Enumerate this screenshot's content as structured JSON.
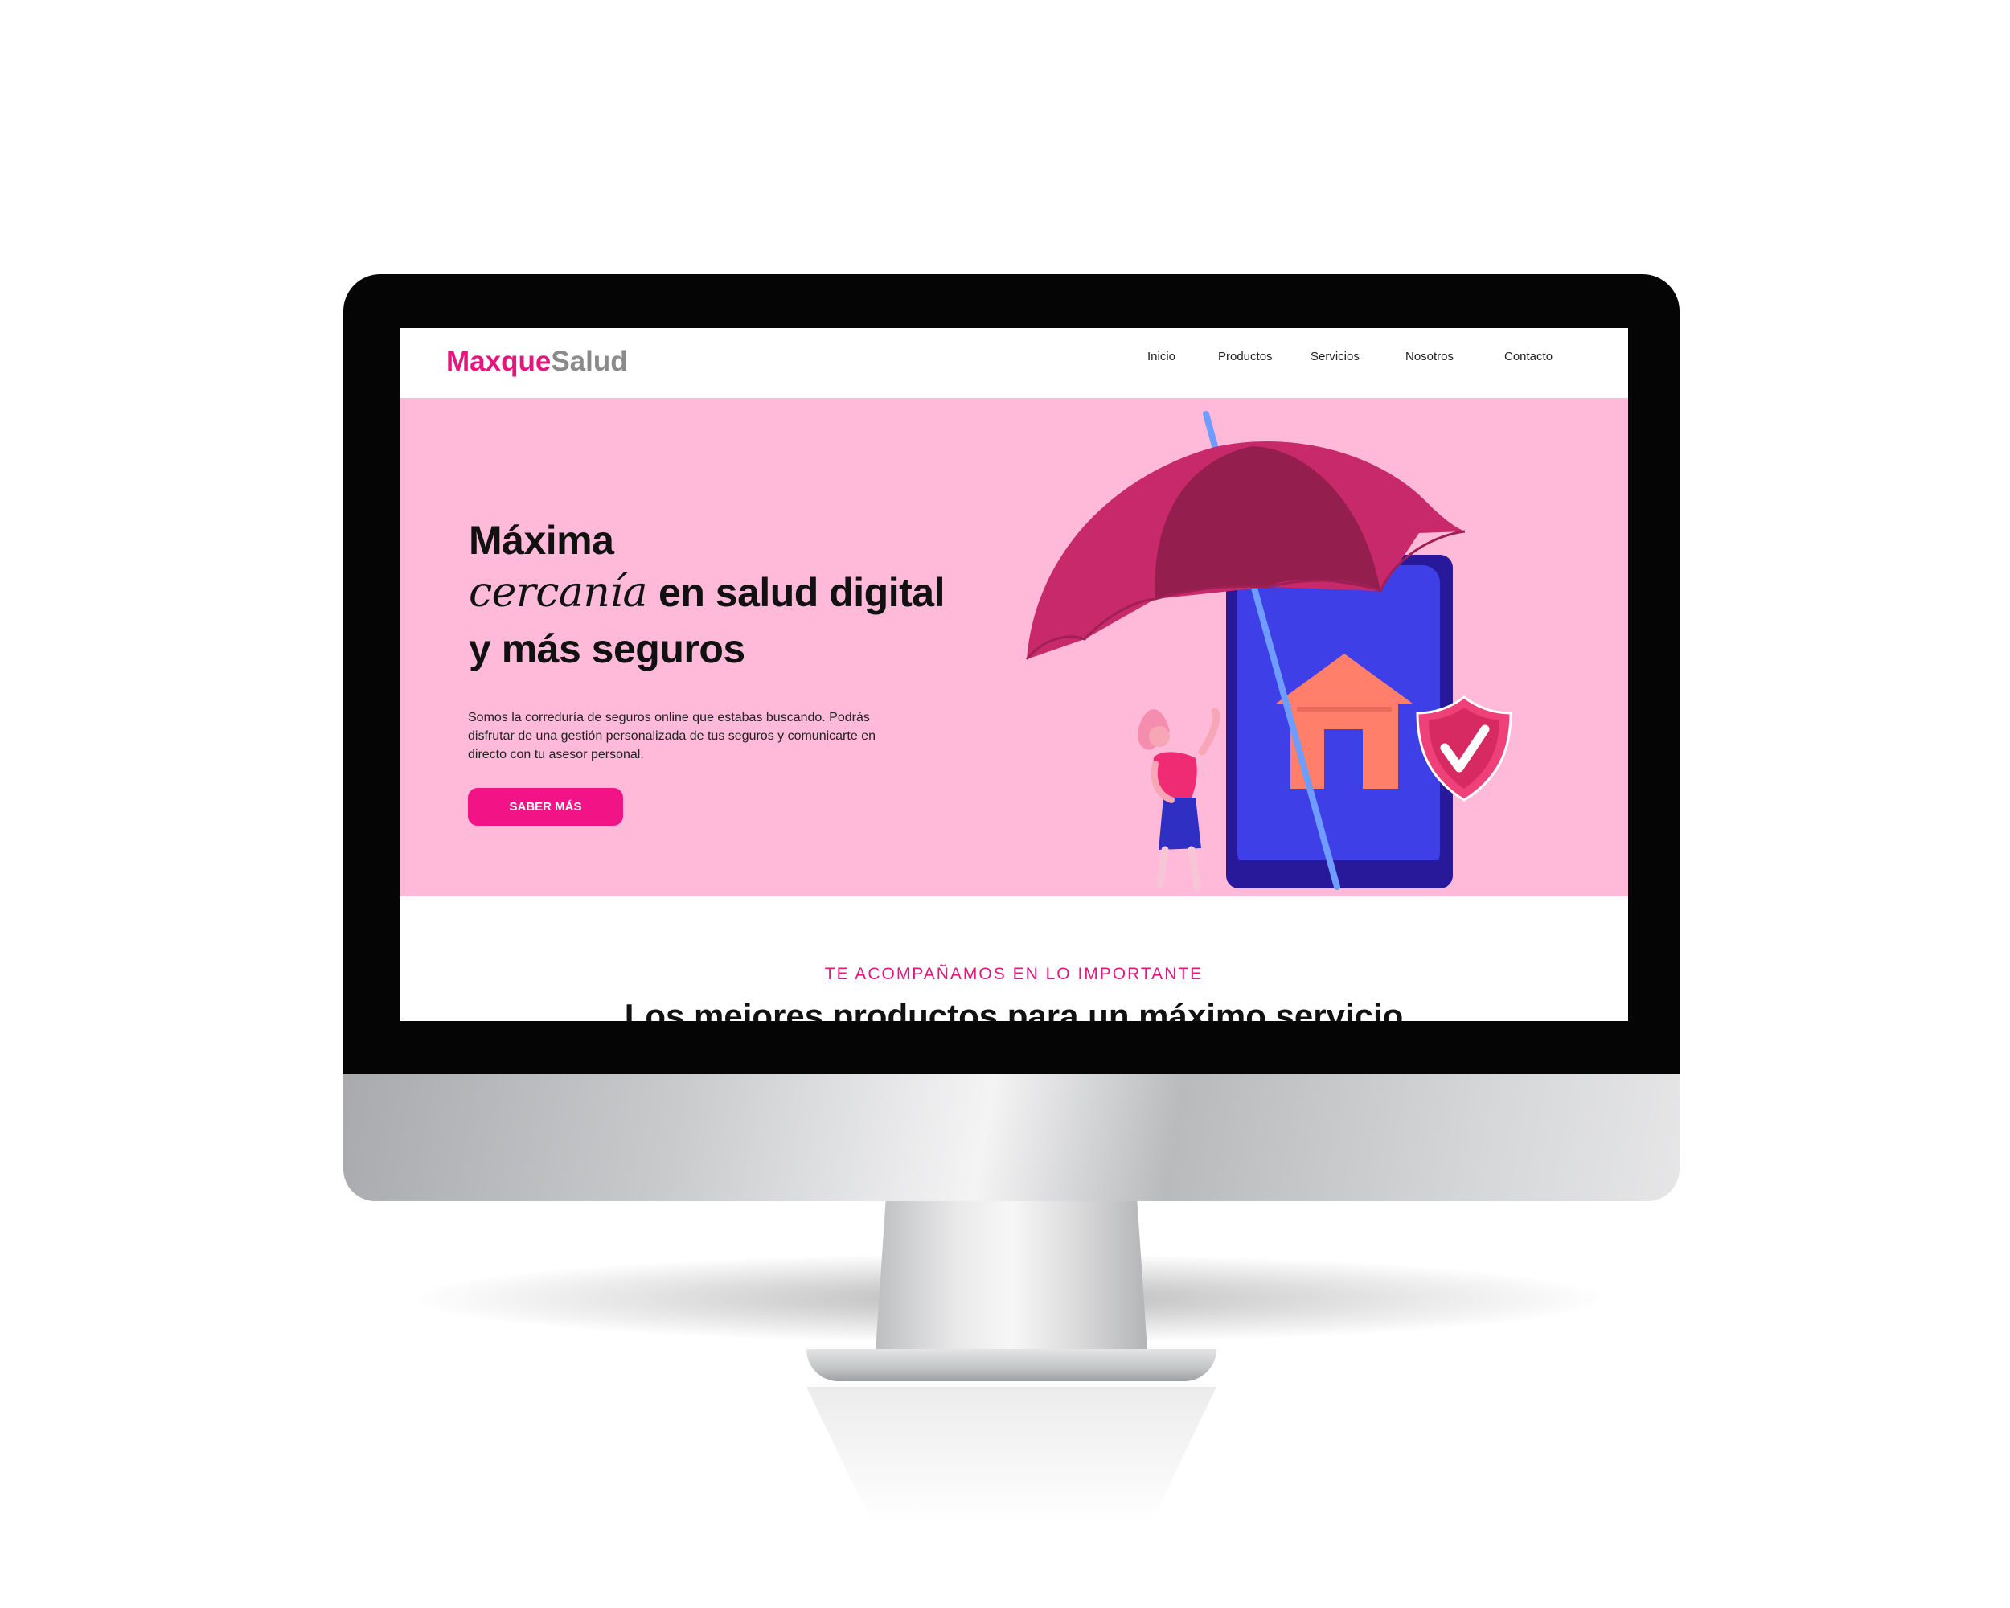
{
  "site": {
    "logo_primary": "Maxque",
    "logo_secondary": "Salud"
  },
  "nav": {
    "items": [
      {
        "label": "Inicio"
      },
      {
        "label": "Productos"
      },
      {
        "label": "Servicios"
      },
      {
        "label": "Nosotros"
      },
      {
        "label": "Contacto"
      }
    ]
  },
  "hero": {
    "title_line1": "Máxima",
    "title_script": "cercanía",
    "title_line2_rest": "en salud digital",
    "title_line3": "y más seguros",
    "description": "Somos la correduría de seguros online que estabas buscando. Podrás disfrutar de una gestión personalizada de tus seguros y comunicarte en directo con tu asesor personal.",
    "button_label": "SABER MÁS"
  },
  "section": {
    "eyebrow": "TE ACOMPAÑAMOS EN LO IMPORTANTE",
    "title": "Los mejores productos para un máximo servicio"
  },
  "colors": {
    "brand_pink": "#e6157e",
    "hero_background": "#ffb9d9",
    "button": "#f21387",
    "phone_blue": "#3f3fe8",
    "umbrella_red": "#c8296a"
  },
  "icons": [
    "umbrella-illustration",
    "phone-illustration",
    "house-icon",
    "shield-check-icon",
    "woman-illustration"
  ]
}
